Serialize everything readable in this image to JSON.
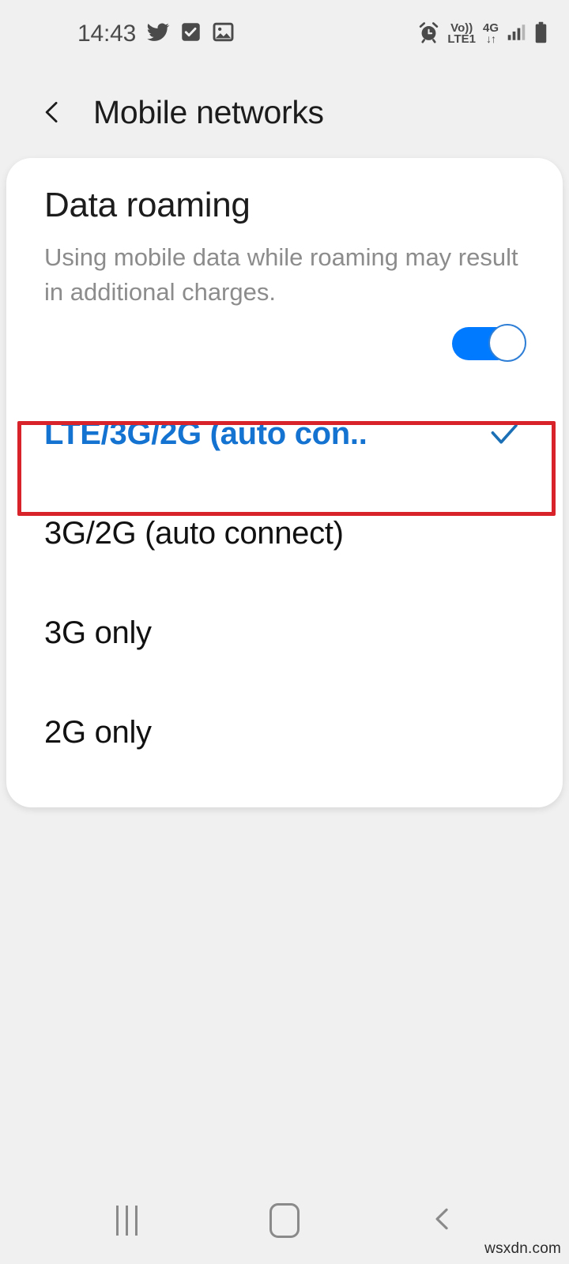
{
  "status_bar": {
    "time": "14:43",
    "left_icons": [
      {
        "name": "twitter-icon",
        "label": "Twitter"
      },
      {
        "name": "task-checkbox-icon",
        "label": "Tasks"
      },
      {
        "name": "gallery-image-icon",
        "label": "Gallery"
      }
    ],
    "right_icons": [
      {
        "name": "alarm-clock-icon",
        "label": "Alarm"
      }
    ],
    "volte_top": "Vo))",
    "volte_bottom": "LTE1",
    "network_type": "4G",
    "network_arrows": "↓↑",
    "signal": "signal-bars-icon",
    "battery": "battery-icon"
  },
  "app_bar": {
    "back_icon": "back-chevron-icon",
    "title": "Mobile networks"
  },
  "roaming": {
    "title": "Data roaming",
    "description": "Using mobile data while roaming may result in additional charges.",
    "toggle_state": "on",
    "toggle_label": "Data roaming toggle"
  },
  "network_mode_options": [
    {
      "label": "LTE/3G/2G (auto con..",
      "selected": true,
      "check_icon": "check-icon"
    },
    {
      "label": "3G/2G (auto connect)",
      "selected": false,
      "check_icon": ""
    },
    {
      "label": "3G only",
      "selected": false,
      "check_icon": ""
    },
    {
      "label": "2G only",
      "selected": false,
      "check_icon": ""
    }
  ],
  "annotation": {
    "type": "highlight-rectangle",
    "target": "LTE/3G/2G (auto con..",
    "color": "#d8232a"
  },
  "nav_bar": {
    "recents_label": "Recents",
    "home_label": "Home",
    "back_label": "Back"
  },
  "watermark": "wsxdn.com",
  "colors": {
    "background": "#f0f0f0",
    "card": "#ffffff",
    "accent_blue": "#1473d1",
    "toggle_blue": "#007aff",
    "annotation_red": "#d8232a",
    "primary_text": "#1c1c1c",
    "secondary_text": "#8c8c8c"
  }
}
